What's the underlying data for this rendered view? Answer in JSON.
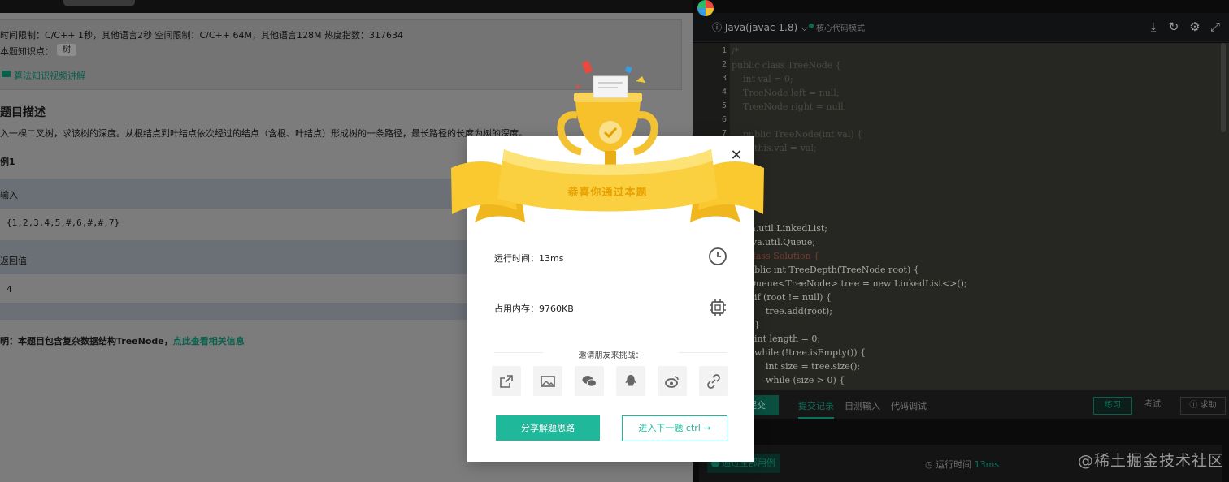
{
  "problem": {
    "limits_text": "时间限制：C/C++ 1秒，其他语言2秒    空间限制：C/C++ 64M，其他语言128M    热度指数：317634",
    "knowledge_label": "本题知识点：",
    "knowledge_tag": "树",
    "video_link": "算法知识视频讲解",
    "desc_title": "题目描述",
    "desc_text": "入一棵二叉树，求该树的深度。从根结点到叶结点依次经过的结点（含根、叶结点）形成树的一条路径，最长路径的长度为树的深度。",
    "example_title": "例1",
    "input_label": "输入",
    "input_value": "{1,2,3,4,5,#,6,#,#,7}",
    "return_label": "返回值",
    "return_value": "4",
    "note_text": "明：本题目包含复杂数据结构TreeNode，",
    "note_link": "点此查看相关信息"
  },
  "editor": {
    "language": "Java(javac 1.8)",
    "mode_label": "核心代码模式",
    "line_numbers": [
      "1",
      "2",
      "3",
      "4",
      "5",
      "6",
      "7"
    ],
    "header_lines": [
      "/*",
      "public class TreeNode {",
      "    int val = 0;",
      "    TreeNode left = null;",
      "    TreeNode right = null;",
      "",
      "    public TreeNode(int val) {",
      "        this.val = val;"
    ],
    "code_lines": [
      "  java.util.LinkedList;",
      "  t java.util.Queue;",
      "  ic class Solution {",
      "    public int TreeDepth(TreeNode root) {",
      "      Queue<TreeNode> tree = new LinkedList<>();",
      "        if (root != null) {",
      "            tree.add(root);",
      "        }",
      "        int length = 0;",
      "        while (!tree.isEmpty()) {",
      "            int size = tree.size();",
      "            while (size > 0) {"
    ],
    "submit_label": "提交",
    "tabs": [
      "提交记录",
      "自测输入",
      "代码调试"
    ],
    "modes": [
      "练习",
      "考试"
    ],
    "help_label": "求助",
    "pass_label": "通过全部用例",
    "runtime_label": "运行时间",
    "runtime_value": "13ms"
  },
  "modal": {
    "congrats": "恭喜你通过本题",
    "runtime_text": "运行时间：13ms",
    "memory_text": "占用内存：9760KB",
    "invite_text": "邀请朋友来挑战：",
    "share_icons": [
      "external-share-icon",
      "image-icon",
      "wechat-icon",
      "qq-icon",
      "weibo-icon",
      "link-icon"
    ],
    "share_button": "分享解题思路",
    "next_button": "进入下一题 ctrl ➞"
  },
  "watermark": "@稀土掘金技术社区",
  "colors": {
    "accent": "#1fb89b",
    "gold": "#f7c12b",
    "overlay_left": "#7c7c7c",
    "editor_bg": "#262723"
  }
}
